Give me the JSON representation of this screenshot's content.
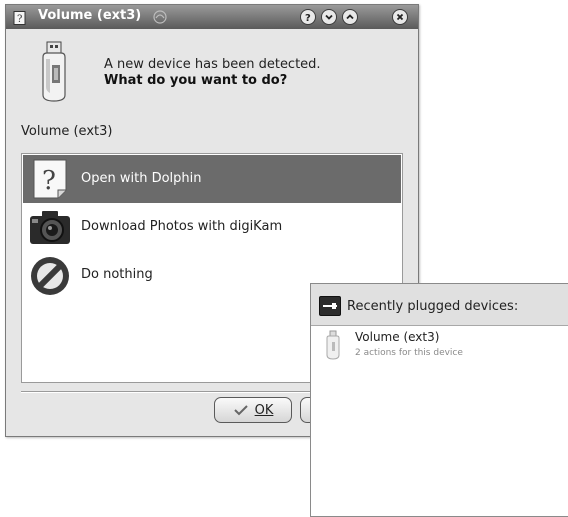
{
  "dialog": {
    "title": "Volume (ext3)",
    "message_line1": "A new device has been detected.",
    "message_line2": "What do you want to do?",
    "device_label": "Volume (ext3)",
    "actions": [
      {
        "label": "Open with Dolphin",
        "icon": "question-document-icon",
        "selected": true
      },
      {
        "label": "Download Photos with digiKam",
        "icon": "camera-icon",
        "selected": false
      },
      {
        "label": "Do nothing",
        "icon": "no-entry-icon",
        "selected": false
      }
    ],
    "ok_label": "OK",
    "titlebar_buttons": [
      "help-icon",
      "minimize-icon",
      "maximize-icon",
      "close-icon"
    ]
  },
  "notifier": {
    "title": "Recently plugged devices:",
    "item_title": "Volume (ext3)",
    "item_subtitle": "2 actions for this device"
  },
  "colors": {
    "selection": "#6b6b6b",
    "titlebar": "#5a5a5a",
    "window_bg": "#e6e6e6"
  }
}
